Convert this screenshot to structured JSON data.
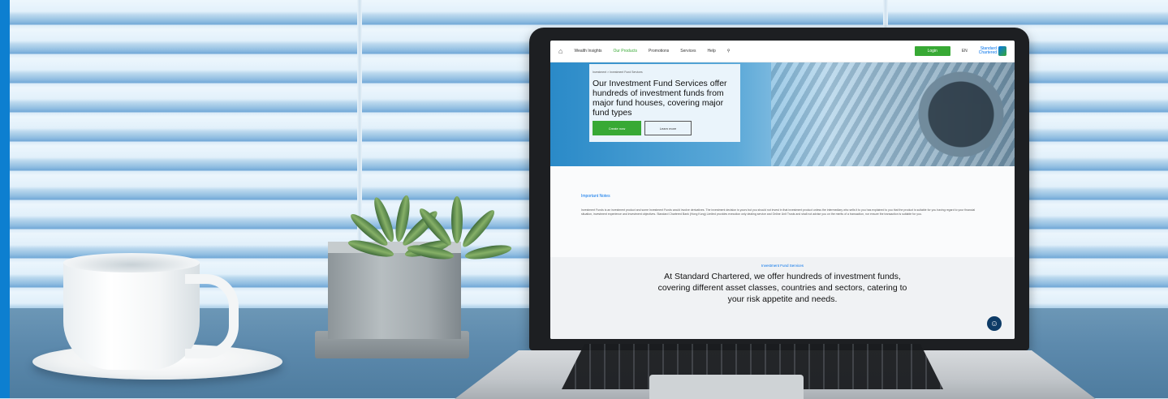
{
  "website": {
    "nav": {
      "home_icon": "home-icon",
      "items": [
        "Wealth Insights",
        "Our Products",
        "Promotions",
        "Services",
        "Help"
      ],
      "search_icon": "search-icon",
      "login_label": "Login",
      "language": "EN",
      "logo_text_line1": "Standard",
      "logo_text_line2": "Chartered"
    },
    "hero": {
      "breadcrumb": "Investment > Investment Fund Services",
      "title": "Our Investment Fund Services offer hundreds of investment funds from major fund houses, covering major fund types",
      "primary_button": "Create now",
      "secondary_button": "Learn more"
    },
    "notes": {
      "title": "Important Notes",
      "body": "Investment Funds is an investment product and some Investment Funds would involve derivatives. The investment decision is yours but you should not invest in that investment product unless the intermediary who sells it to you has explained to you that the product is suitable for you having regard to your financial situation, investment experience and investment objectives. Standard Chartered Bank (Hong Kong) Limited provides execution only dealing service and Online Unit Trusts and shall not advise you on the merits of a transaction, nor ensure the transaction is suitable for you."
    },
    "services": {
      "label": "Investment Fund Services",
      "text": "At Standard Chartered, we offer hundreds of investment funds, covering different asset classes, countries and sectors, catering to your risk appetite and needs."
    },
    "chat_icon": "chat-bot-icon"
  },
  "colors": {
    "accent": "#0d7fd0",
    "brand_green": "#38a935",
    "brand_blue": "#0473ea"
  }
}
